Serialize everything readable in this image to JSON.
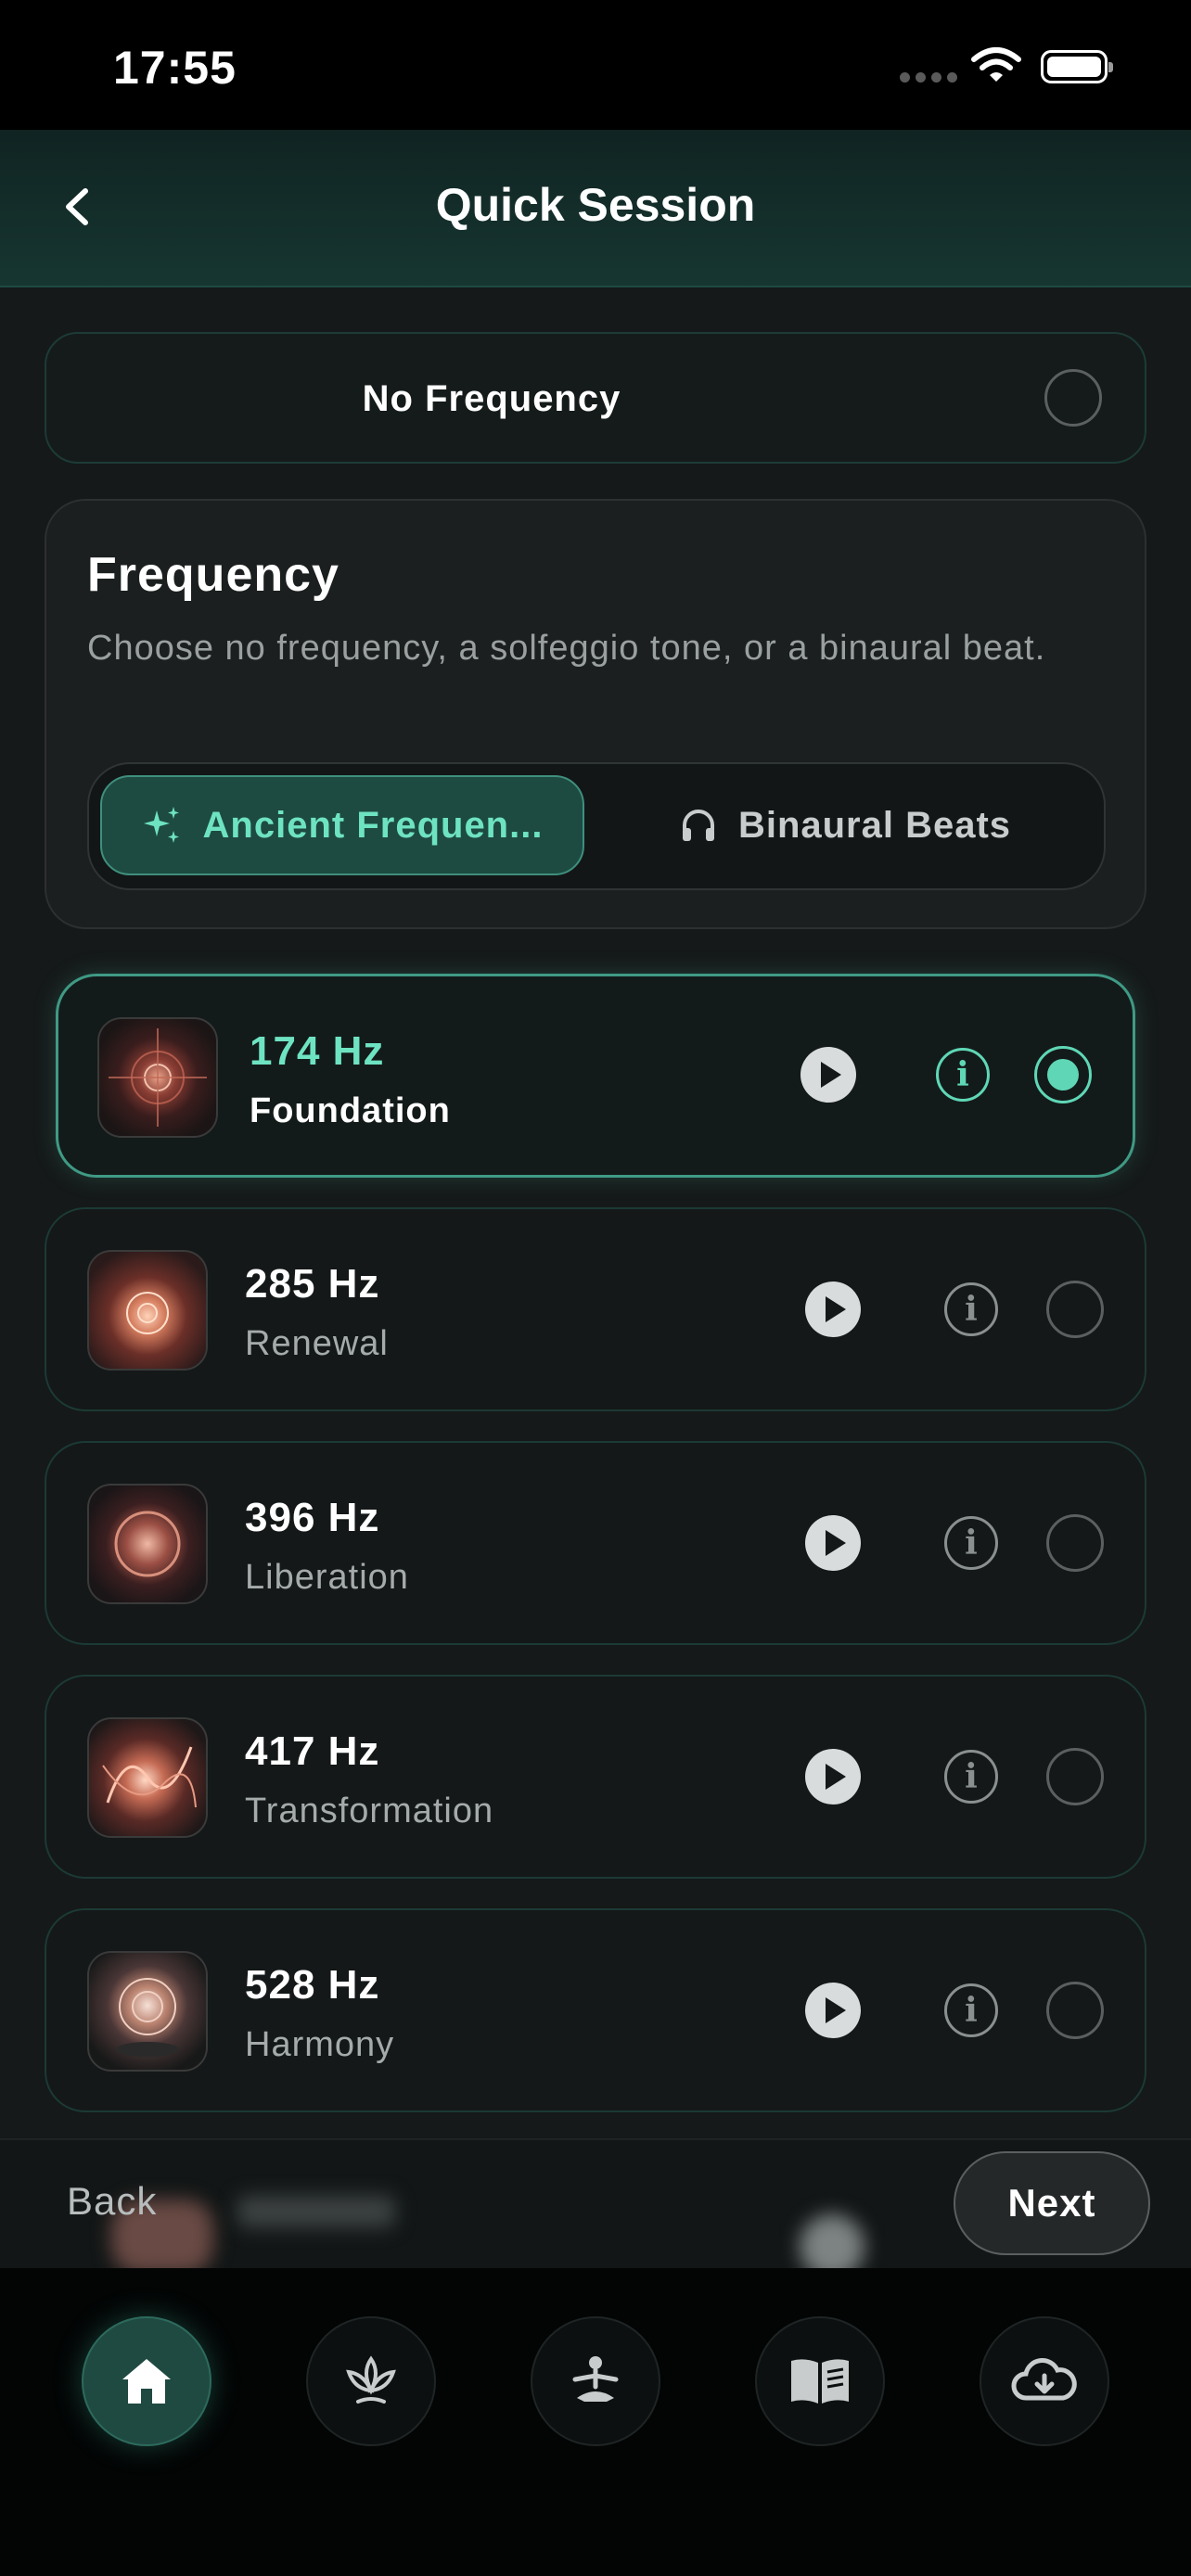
{
  "status_bar": {
    "time": "17:55"
  },
  "header": {
    "title": "Quick Session"
  },
  "no_frequency": {
    "label": "No Frequency",
    "selected": false
  },
  "frequency_card": {
    "title": "Frequency",
    "description": "Choose no frequency, a solfeggio tone, or a binaural beat.",
    "tabs": [
      {
        "label": "Ancient Frequen...",
        "icon": "sparkles-icon",
        "active": true
      },
      {
        "label": "Binaural Beats",
        "icon": "headphones-icon",
        "active": false
      }
    ]
  },
  "frequencies": [
    {
      "hz": "174 Hz",
      "name": "Foundation",
      "selected": true
    },
    {
      "hz": "285 Hz",
      "name": "Renewal",
      "selected": false
    },
    {
      "hz": "396 Hz",
      "name": "Liberation",
      "selected": false
    },
    {
      "hz": "417 Hz",
      "name": "Transformation",
      "selected": false
    },
    {
      "hz": "528 Hz",
      "name": "Harmony",
      "selected": false
    }
  ],
  "footer": {
    "back_label": "Back",
    "next_label": "Next"
  },
  "tab_bar": {
    "items": [
      {
        "icon": "home-icon",
        "active": true
      },
      {
        "icon": "lotus-icon",
        "active": false
      },
      {
        "icon": "meditation-icon",
        "active": false
      },
      {
        "icon": "book-icon",
        "active": false
      },
      {
        "icon": "cloud-download-icon",
        "active": false
      }
    ]
  },
  "colors": {
    "accent": "#5fd7b6",
    "background": "#151919"
  }
}
